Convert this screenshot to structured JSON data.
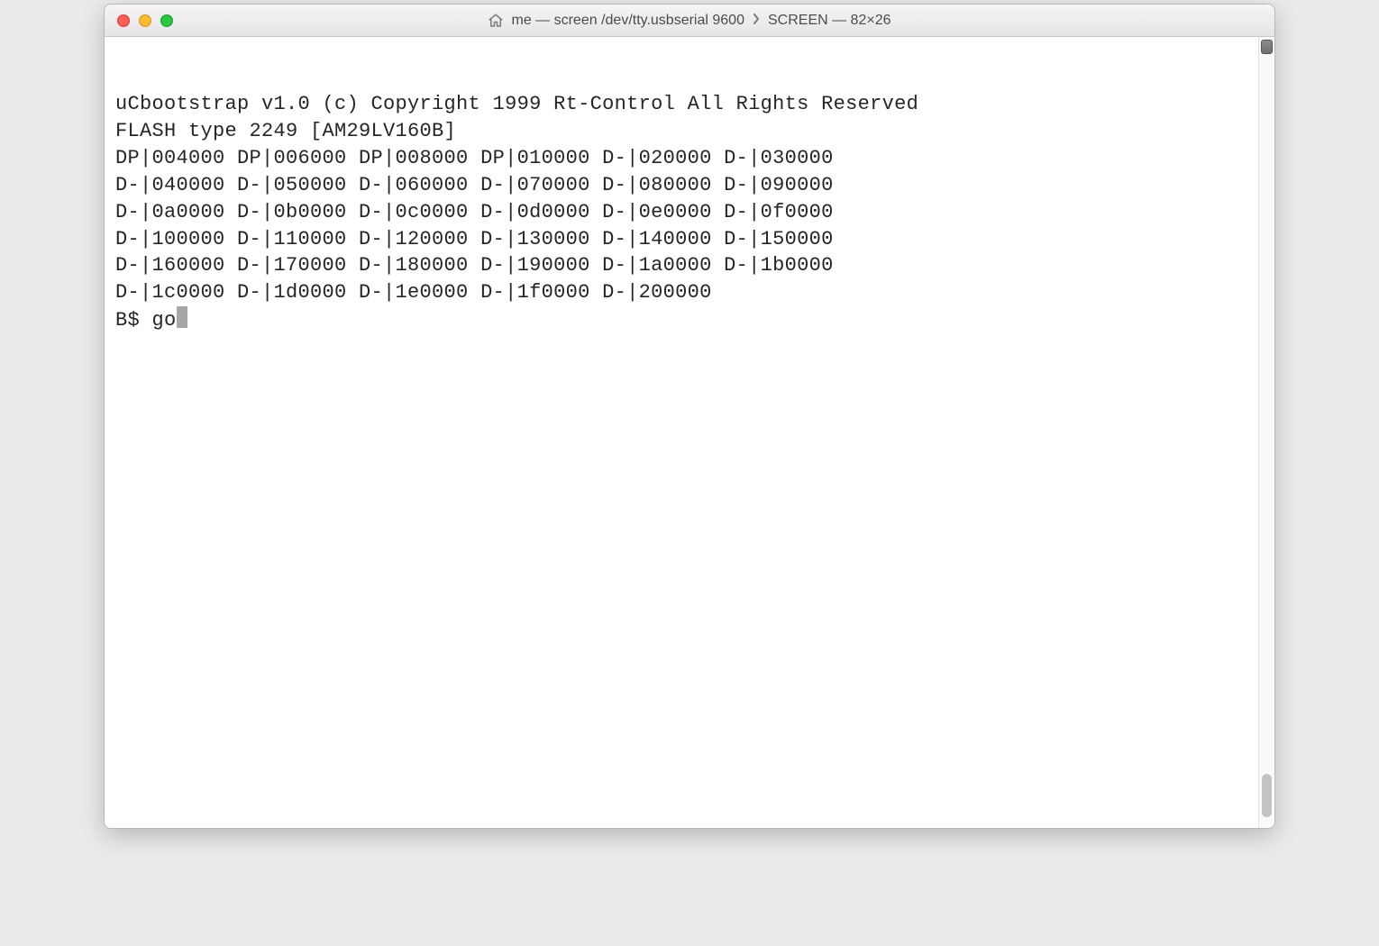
{
  "window": {
    "title_left": "me — screen /dev/tty.usbserial 9600",
    "title_right": "SCREEN — 82×26",
    "home_icon": "home-icon"
  },
  "terminal": {
    "lines": [
      "uCbootstrap v1.0 (c) Copyright 1999 Rt-Control All Rights Reserved",
      "FLASH type 2249 [AM29LV160B]",
      "DP|004000 DP|006000 DP|008000 DP|010000 D-|020000 D-|030000",
      "D-|040000 D-|050000 D-|060000 D-|070000 D-|080000 D-|090000",
      "D-|0a0000 D-|0b0000 D-|0c0000 D-|0d0000 D-|0e0000 D-|0f0000",
      "D-|100000 D-|110000 D-|120000 D-|130000 D-|140000 D-|150000",
      "D-|160000 D-|170000 D-|180000 D-|190000 D-|1a0000 D-|1b0000",
      "D-|1c0000 D-|1d0000 D-|1e0000 D-|1f0000 D-|200000"
    ],
    "prompt": "B$ ",
    "entered_command": "go"
  }
}
